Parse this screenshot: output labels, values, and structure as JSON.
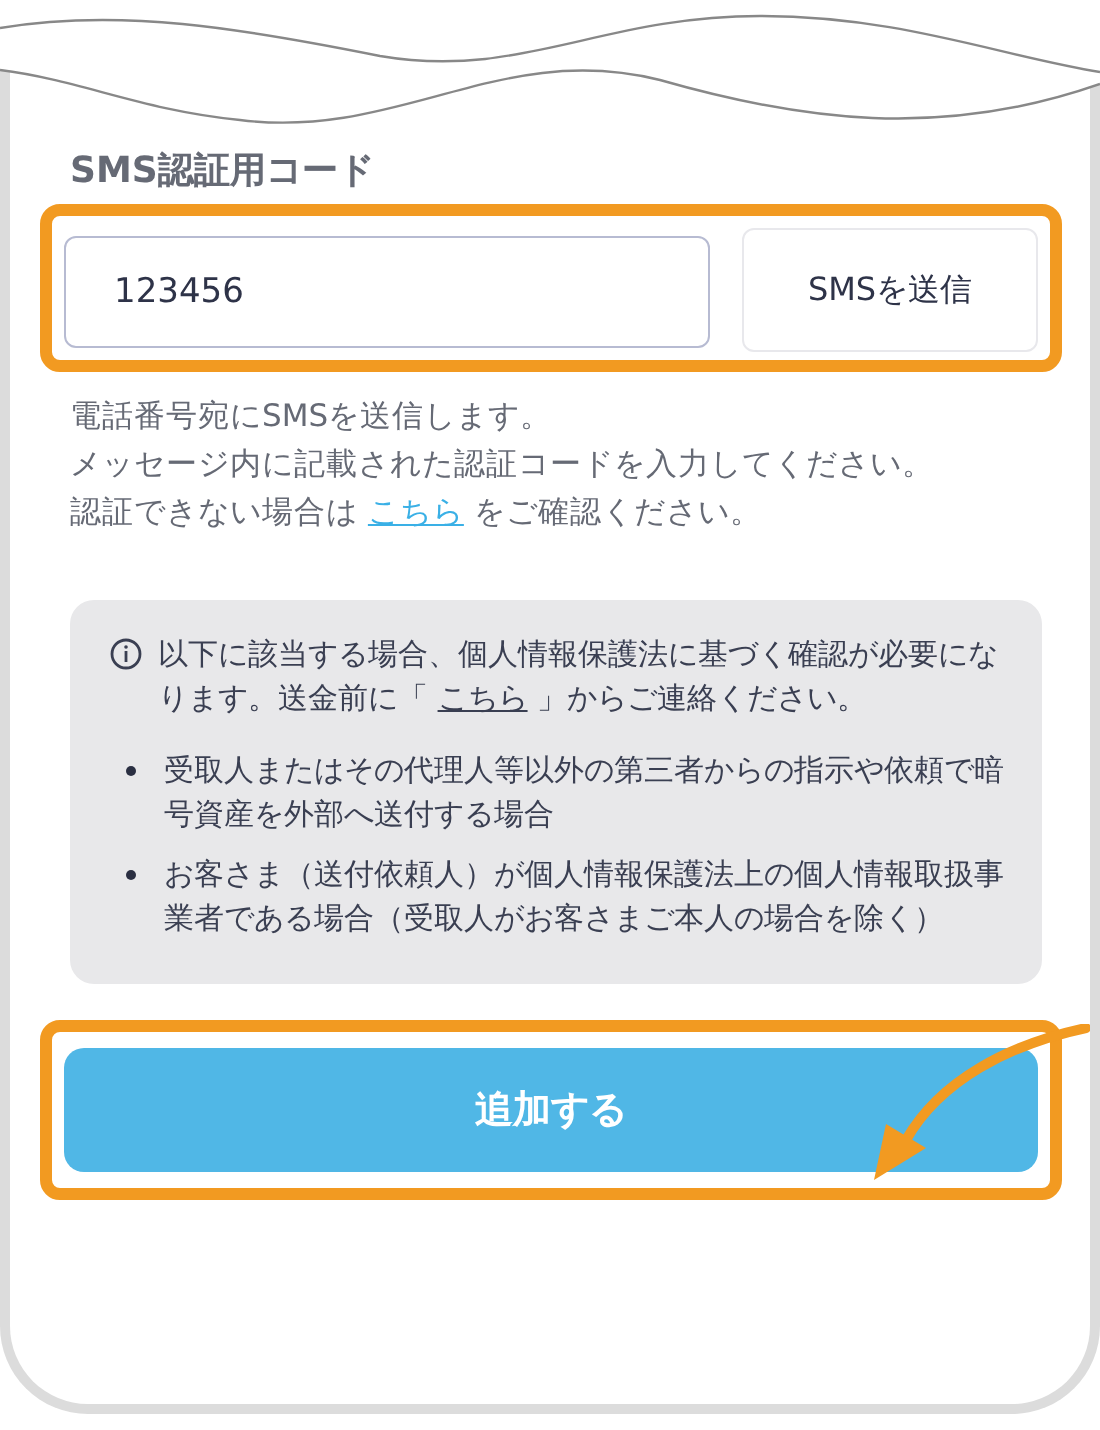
{
  "section": {
    "title": "SMS認証用コード"
  },
  "code_field": {
    "value": "123456"
  },
  "send_button": {
    "label": "SMSを送信"
  },
  "help_lines": [
    "電話番号宛にSMSを送信します。",
    "メッセージ内に記載された認証コードを入力してください。"
  ],
  "help_link_line": {
    "before": "認証できない場合は",
    "link": "こちら",
    "after": "をご確認ください。"
  },
  "notice": {
    "before": "以下に該当する場合、個人情報保護法に基づく確認が必要になります。送金前に「",
    "link": "こちら",
    "after": "」からご連絡ください。",
    "bullets": [
      "受取人またはその代理人等以外の第三者からの指示や依頼で暗号資産を外部へ送付する場合",
      "お客さま（送付依頼人）が個人情報保護法上の個人情報取扱事業者である場合（受取人がお客さまご本人の場合を除く）"
    ]
  },
  "submit_button": {
    "label": "追加する"
  }
}
